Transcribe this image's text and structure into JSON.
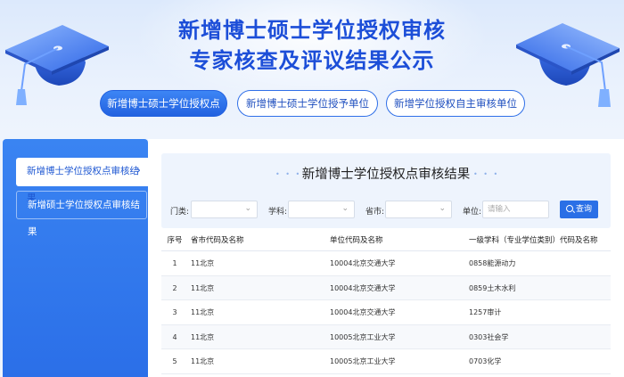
{
  "banner": {
    "title_line1": "新增博士硕士学位授权审核",
    "title_line2": "专家核查及评议结果公示"
  },
  "tabs": [
    {
      "label": "新增博士硕士学位授权点",
      "active": true
    },
    {
      "label": "新增博士硕士学位授予单位",
      "active": false
    },
    {
      "label": "新增学位授权自主审核单位",
      "active": false
    }
  ],
  "sidebar": {
    "items": [
      {
        "label": "新增博士学位授权点审核结果",
        "active": true
      },
      {
        "label": "新增硕士学位授权点审核结果",
        "active": false
      }
    ]
  },
  "panel": {
    "title": "新增博士学位授权点审核结果"
  },
  "filters": {
    "category_label": "门类:",
    "subject_label": "学科:",
    "province_label": "省市:",
    "unit_label": "单位:",
    "unit_placeholder": "请输入",
    "search_button": "查询"
  },
  "table": {
    "headers": {
      "no": "序号",
      "province": "省市代码及名称",
      "unit": "单位代码及名称",
      "subject": "一级学科（专业学位类别）代码及名称"
    },
    "rows": [
      {
        "no": "1",
        "province": "11北京",
        "unit": "10004北京交通大学",
        "subject": "0858能源动力"
      },
      {
        "no": "2",
        "province": "11北京",
        "unit": "10004北京交通大学",
        "subject": "0859土木水利"
      },
      {
        "no": "3",
        "province": "11北京",
        "unit": "10004北京交通大学",
        "subject": "1257审计"
      },
      {
        "no": "4",
        "province": "11北京",
        "unit": "10005北京工业大学",
        "subject": "0303社会学"
      },
      {
        "no": "5",
        "province": "11北京",
        "unit": "10005北京工业大学",
        "subject": "0703化学"
      }
    ]
  },
  "colors": {
    "accent": "#2a6fe6",
    "title": "#1c4ed8",
    "sidebar": "#2f76ec"
  }
}
